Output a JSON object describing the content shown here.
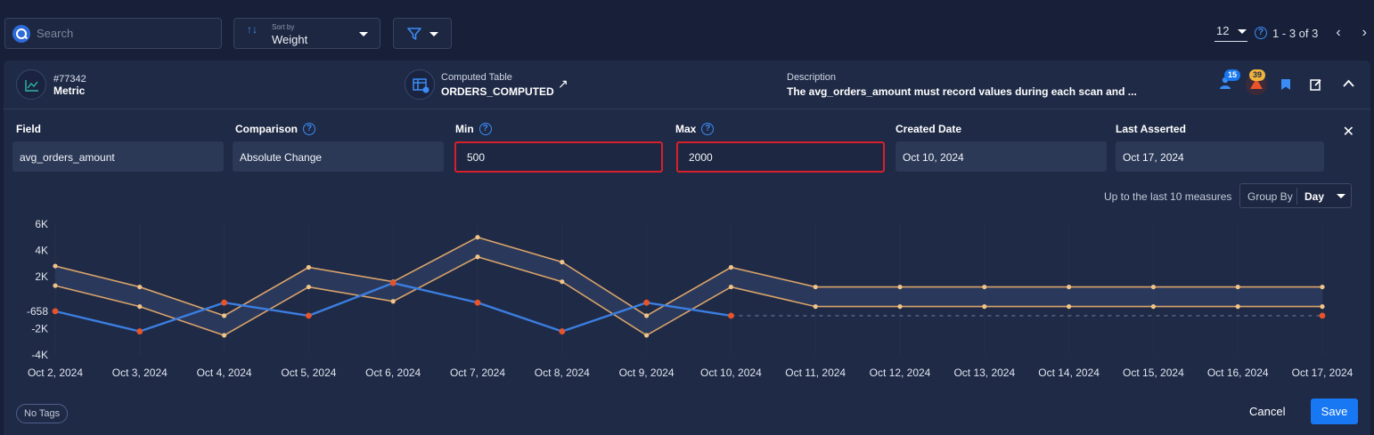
{
  "search": {
    "placeholder": "Search"
  },
  "sort": {
    "small_label": "Sort by",
    "value": "Weight"
  },
  "pagination": {
    "per_page": "12",
    "range": "1 - 3 of 3"
  },
  "card": {
    "id": "#77342",
    "rule_type": "Metric",
    "computed_table_label": "Computed Table",
    "computed_table_name": "ORDERS_COMPUTED",
    "description_label": "Description",
    "description": "The avg_orders_amount must record values during each scan and ...",
    "badge_blue": "15",
    "badge_orange": "39"
  },
  "fields": {
    "field": {
      "label": "Field",
      "value": "avg_orders_amount"
    },
    "comparison": {
      "label": "Comparison",
      "value": "Absolute Change"
    },
    "min": {
      "label": "Min",
      "value": "500"
    },
    "max": {
      "label": "Max",
      "value": "2000"
    },
    "created": {
      "label": "Created Date",
      "value": "Oct 10, 2024"
    },
    "last_asserted": {
      "label": "Last Asserted",
      "value": "Oct 17, 2024"
    }
  },
  "chart_controls": {
    "last_measures": "Up to the last 10 measures",
    "group_by_label": "Group By",
    "group_by_value": "Day"
  },
  "footer": {
    "tags": "No Tags",
    "cancel": "Cancel",
    "save": "Save"
  },
  "colors": {
    "measured": "#3b7ee0",
    "bounds": "#d9a36a",
    "anomaly": "#e8532a",
    "accent": "#1877f2"
  },
  "chart_data": {
    "type": "line",
    "x": [
      "Oct 2, 2024",
      "Oct 3, 2024",
      "Oct 4, 2024",
      "Oct 5, 2024",
      "Oct 6, 2024",
      "Oct 7, 2024",
      "Oct 8, 2024",
      "Oct 9, 2024",
      "Oct 10, 2024",
      "Oct 11, 2024",
      "Oct 12, 2024",
      "Oct 13, 2024",
      "Oct 14, 2024",
      "Oct 15, 2024",
      "Oct 16, 2024",
      "Oct 17, 2024"
    ],
    "y_ticks": [
      "6K",
      "4K",
      "2K",
      "-658",
      "-2K",
      "-4K"
    ],
    "y_tick_values": [
      6000,
      4000,
      2000,
      -658,
      -2000,
      -4000
    ],
    "ylim": [
      -4000,
      6000
    ],
    "series": [
      {
        "values": [
          -658,
          -2200,
          0,
          -1000,
          1500,
          0,
          -2200,
          0,
          -1000,
          null,
          null,
          null,
          null,
          null,
          null,
          -1000
        ],
        "anomalies": [
          0,
          1,
          2,
          3,
          4,
          5,
          6,
          7,
          8,
          15
        ]
      },
      {
        "values": [
          2800,
          1200,
          -1000,
          2700,
          1600,
          5000,
          3100,
          -1000,
          2700,
          1200,
          1200,
          1200,
          1200,
          1200,
          1200,
          1200
        ]
      },
      {
        "values": [
          1300,
          -300,
          -2500,
          1200,
          100,
          3500,
          1600,
          -2500,
          1200,
          -300,
          -300,
          -300,
          -300,
          -300,
          -300,
          -300
        ]
      }
    ]
  }
}
